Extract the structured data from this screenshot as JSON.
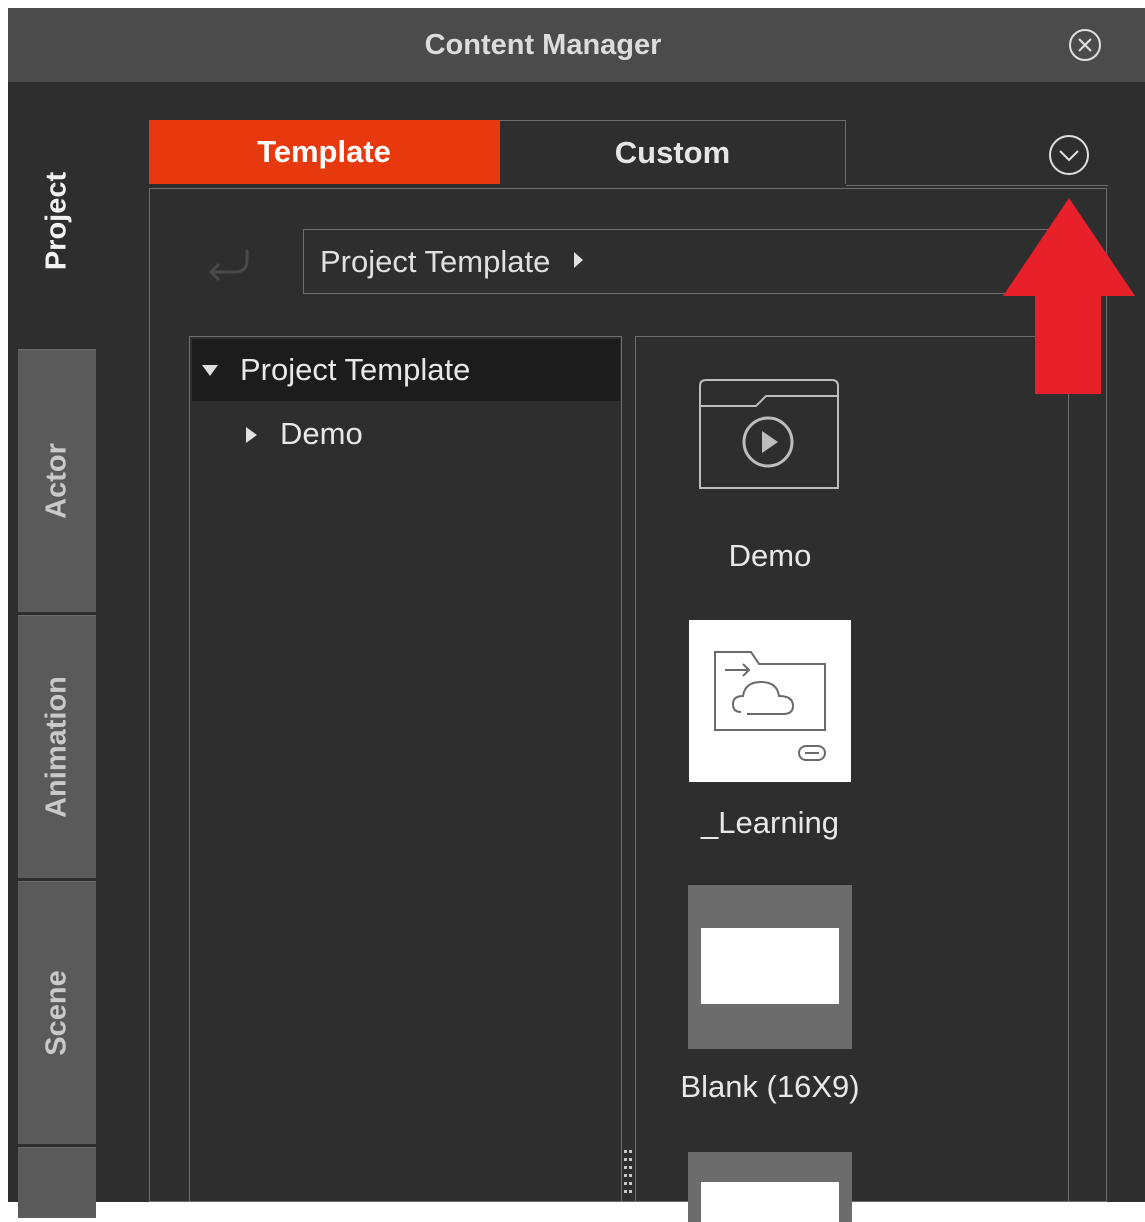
{
  "window": {
    "title": "Content Manager"
  },
  "sidebar": {
    "tabs": [
      {
        "label": "Project",
        "active": true
      },
      {
        "label": "Actor",
        "active": false
      },
      {
        "label": "Animation",
        "active": false
      },
      {
        "label": "Scene",
        "active": false
      }
    ]
  },
  "top_tabs": [
    {
      "label": "Template",
      "active": true
    },
    {
      "label": "Custom",
      "active": false
    }
  ],
  "breadcrumb": {
    "path": "Project Template"
  },
  "tree": {
    "root": {
      "label": "Project Template",
      "expanded": true
    },
    "children": [
      {
        "label": "Demo",
        "expanded": false
      }
    ]
  },
  "grid_items": [
    {
      "label": "Demo",
      "icon": "folder-play-icon"
    },
    {
      "label": "_Learning",
      "icon": "cloud-folder-link-icon"
    },
    {
      "label": "Blank (16X9)",
      "icon": "blank-template-thumbnail"
    },
    {
      "label": "",
      "icon": "blank-template-thumbnail"
    }
  ],
  "colors": {
    "accent": "#e8390e",
    "background": "#2e2e2e",
    "titlebar": "#4b4b4b",
    "annotation_arrow": "#e8202a"
  },
  "annotation": {
    "type": "arrow",
    "points_to": "dropdown-button"
  }
}
